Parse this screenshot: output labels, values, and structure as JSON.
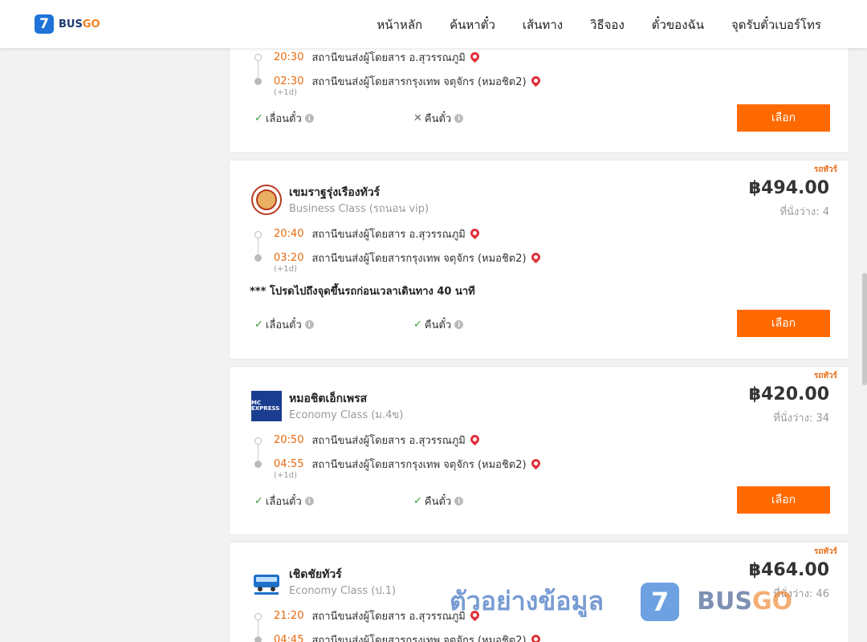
{
  "header": {
    "logo_digit": "7",
    "logo_bus": "BUS",
    "logo_go": "GO",
    "nav": [
      "หน้าหลัก",
      "ค้นหาตั๋ว",
      "เส้นทาง",
      "วิธีจอง",
      "ตั๋วของฉัน",
      "จุดรับตั๋วเบอร์โทร"
    ]
  },
  "common": {
    "select_label": "เลือก",
    "tour_tag": "รถทัวร์",
    "change_label": "เลื่อนตั๋ว",
    "refund_label": "คืนตั๋ว",
    "next_day": "(+1d)",
    "check": "✓",
    "cross": "✕",
    "info": "i"
  },
  "trips": [
    {
      "depart_time": "20:30",
      "depart_station": "สถานีขนส่งผู้โดยสาร อ.สุวรรณภูมิ",
      "arrive_time": "02:30",
      "arrive_station": "สถานีขนส่งผู้โดยสารกรุงเทพ จตุจักร (หมอชิต2)",
      "change_allowed": true,
      "refund_allowed": false
    },
    {
      "operator": "เขมราฐรุ่งเรืองทัวร์",
      "class": "Business Class (รถนอน vip)",
      "price": "฿494.00",
      "seats": "ที่นั่งว่าง: 4",
      "depart_time": "20:40",
      "depart_station": "สถานีขนส่งผู้โดยสาร อ.สุวรรณภูมิ",
      "arrive_time": "03:20",
      "arrive_station": "สถานีขนส่งผู้โดยสารกรุงเทพ จตุจักร (หมอชิต2)",
      "note": "*** โปรดไปถึงจุดขึ้นรถก่อนเวลาเดินทาง 40 นาที",
      "change_allowed": true,
      "refund_allowed": true
    },
    {
      "operator": "หมอชิตเอ็กเพรส",
      "class": "Economy Class (ม.4ข)",
      "price": "฿420.00",
      "seats": "ที่นั่งว่าง: 34",
      "logo_text": "MC EXPRESS",
      "depart_time": "20:50",
      "depart_station": "สถานีขนส่งผู้โดยสาร อ.สุวรรณภูมิ",
      "arrive_time": "04:55",
      "arrive_station": "สถานีขนส่งผู้โดยสารกรุงเทพ จตุจักร (หมอชิต2)",
      "change_allowed": true,
      "refund_allowed": true
    },
    {
      "operator": "เชิดชัยทัวร์",
      "class": "Economy Class (ป.1)",
      "price": "฿464.00",
      "seats": "ที่นั่งว่าง: 46",
      "depart_time": "21:20",
      "depart_station": "สถานีขนส่งผู้โดยสาร อ.สุวรรณภูมิ",
      "arrive_time": "04:45",
      "arrive_station": "สถานีขนส่งผู้โดยสารกรุงเทพ จตุจักร (หมอชิต2)"
    }
  ],
  "watermark": {
    "text": "ตัวอย่างข้อมูล",
    "digit": "7",
    "bus": "BUS",
    "go": "GO"
  }
}
